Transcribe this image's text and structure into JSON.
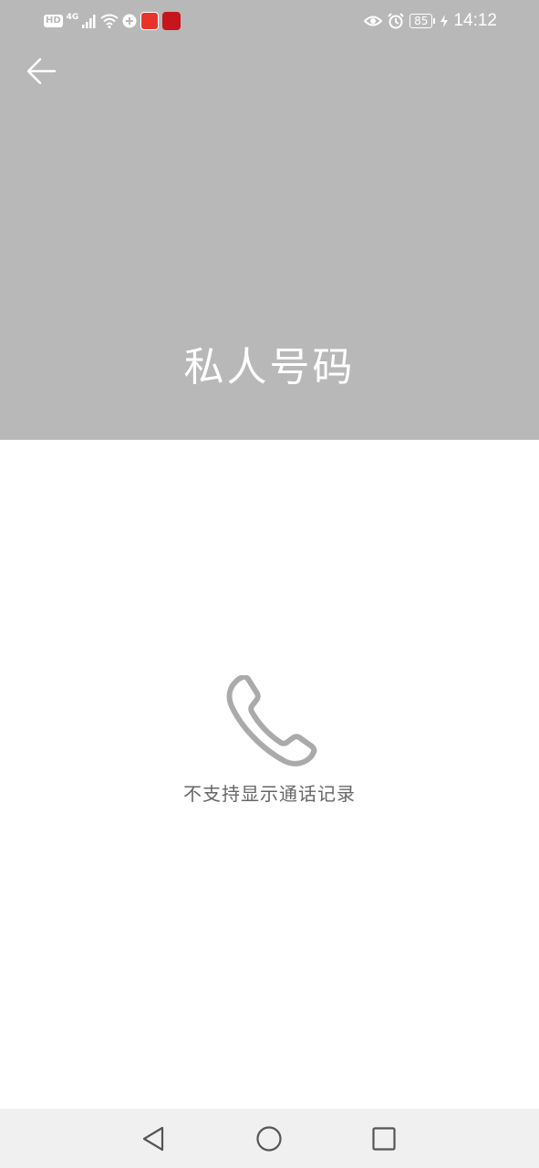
{
  "status_bar": {
    "left_badge": "HD",
    "network": "4G",
    "time": "14:12",
    "battery_level": "85",
    "icons": [
      "hd-icon",
      "signal-icon",
      "wifi-icon",
      "data-saver-icon",
      "toutiao-app-icon",
      "red-app-icon",
      "eye-comfort-icon",
      "alarm-icon",
      "battery-icon",
      "charging-icon"
    ]
  },
  "header": {
    "title": "私人号码",
    "background_color": "#b8b8b8",
    "back_icon": "back-arrow-icon"
  },
  "empty_state": {
    "icon": "phone-icon",
    "message": "不支持显示通话记录"
  },
  "nav_bar": {
    "buttons": [
      "back-triangle-icon",
      "home-circle-icon",
      "recents-square-icon"
    ]
  }
}
